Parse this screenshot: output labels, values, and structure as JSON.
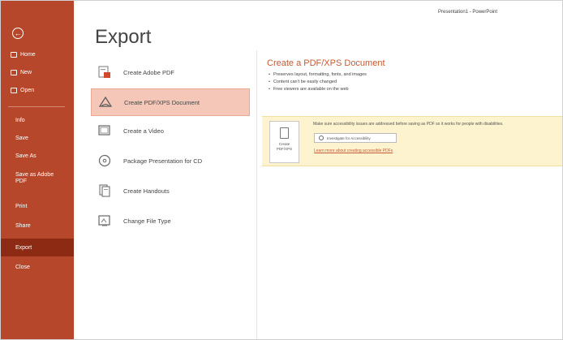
{
  "header": {
    "account": "Presentation1 - PowerPoint",
    "page_title": "Export"
  },
  "sidebar": {
    "back_glyph": "←",
    "items": [
      {
        "label": "Home",
        "icon": "home-icon"
      },
      {
        "label": "New",
        "icon": "new-icon"
      },
      {
        "label": "Open",
        "icon": "open-icon"
      },
      {
        "label": "Info"
      },
      {
        "label": "Save"
      },
      {
        "label": "Save As"
      },
      {
        "label": "Save as Adobe PDF"
      },
      {
        "label": "Print"
      },
      {
        "label": "Share"
      },
      {
        "label": "Export",
        "active": true
      },
      {
        "label": "Close"
      }
    ]
  },
  "options": [
    {
      "label": "Create Adobe PDF",
      "icon": "adobe-pdf-icon"
    },
    {
      "label": "Create PDF/XPS Document",
      "icon": "pdf-xps-document-icon",
      "selected": true
    },
    {
      "label": "Create a Video",
      "icon": "video-icon"
    },
    {
      "label": "Package Presentation for CD",
      "icon": "cd-package-icon"
    },
    {
      "label": "Create Handouts",
      "icon": "handouts-icon"
    },
    {
      "label": "Change File Type",
      "icon": "file-type-icon"
    }
  ],
  "detail": {
    "title": "Create a PDF/XPS Document",
    "bullets": [
      "Preserves layout, formatting, fonts, and images",
      "Content can't be easily changed",
      "Free viewers are available on the web"
    ]
  },
  "notice": {
    "create_label": "Create PDF/XPS",
    "text": "Make sure accessibility issues are addressed before saving as PDF so it works for people with disabilities.",
    "access_button": "Investigate for Accessibility",
    "learn_link": "Learn more about creating accessible PDFs"
  },
  "colors": {
    "sidebar": "#b7472a",
    "sidebar_active": "#8c2a14",
    "accent": "#c55a34",
    "selected_option": "#f4c7b8",
    "notice_bg": "#fdf3cf"
  }
}
